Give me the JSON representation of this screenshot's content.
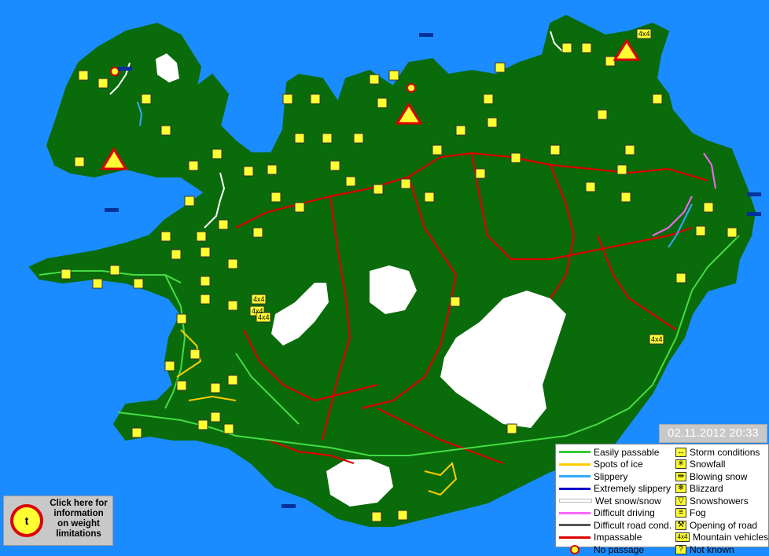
{
  "timestamp": "02.11.2012 20:33",
  "weight_info": {
    "lines": [
      "Click here for",
      "information",
      "on weight",
      "limitations"
    ]
  },
  "legend": {
    "road_conditions": [
      {
        "label": "Easily passable",
        "color": "#33cc33"
      },
      {
        "label": "Spots of ice",
        "color": "#ffcc00"
      },
      {
        "label": "Slippery",
        "color": "#33aaff"
      },
      {
        "label": "Extremely slippery",
        "color": "#0000cc"
      },
      {
        "label": "Wet snow/snow",
        "color": "#ffffff"
      },
      {
        "label": "Difficult driving",
        "color": "#ff66ff"
      },
      {
        "label": "Difficult road cond.",
        "color": "#555555"
      },
      {
        "label": "Impassable",
        "color": "#dd0000"
      },
      {
        "label": "No passage",
        "icon": "no-passage-icon"
      }
    ],
    "weather": [
      {
        "label": "Storm conditions",
        "icon": "storm-icon",
        "glyph": "↔"
      },
      {
        "label": "Snowfall",
        "icon": "snowfall-icon",
        "glyph": "✳"
      },
      {
        "label": "Blowing snow",
        "icon": "blowing-snow-icon",
        "glyph": "⇹"
      },
      {
        "label": "Blizzard",
        "icon": "blizzard-icon",
        "glyph": "❄"
      },
      {
        "label": "Snowshowers",
        "icon": "snowshowers-icon",
        "glyph": "▽"
      },
      {
        "label": "Fog",
        "icon": "fog-icon",
        "glyph": "≡"
      },
      {
        "label": "Opening of road",
        "icon": "opening-road-icon",
        "glyph": "⚒"
      },
      {
        "label": "Mountain vehicles",
        "icon": "mountain-vehicles-icon",
        "glyph": "4x4"
      },
      {
        "label": "Not known",
        "icon": "not-known-icon",
        "glyph": "?"
      }
    ]
  },
  "map_markers": {
    "mountain_label": "4x4"
  }
}
